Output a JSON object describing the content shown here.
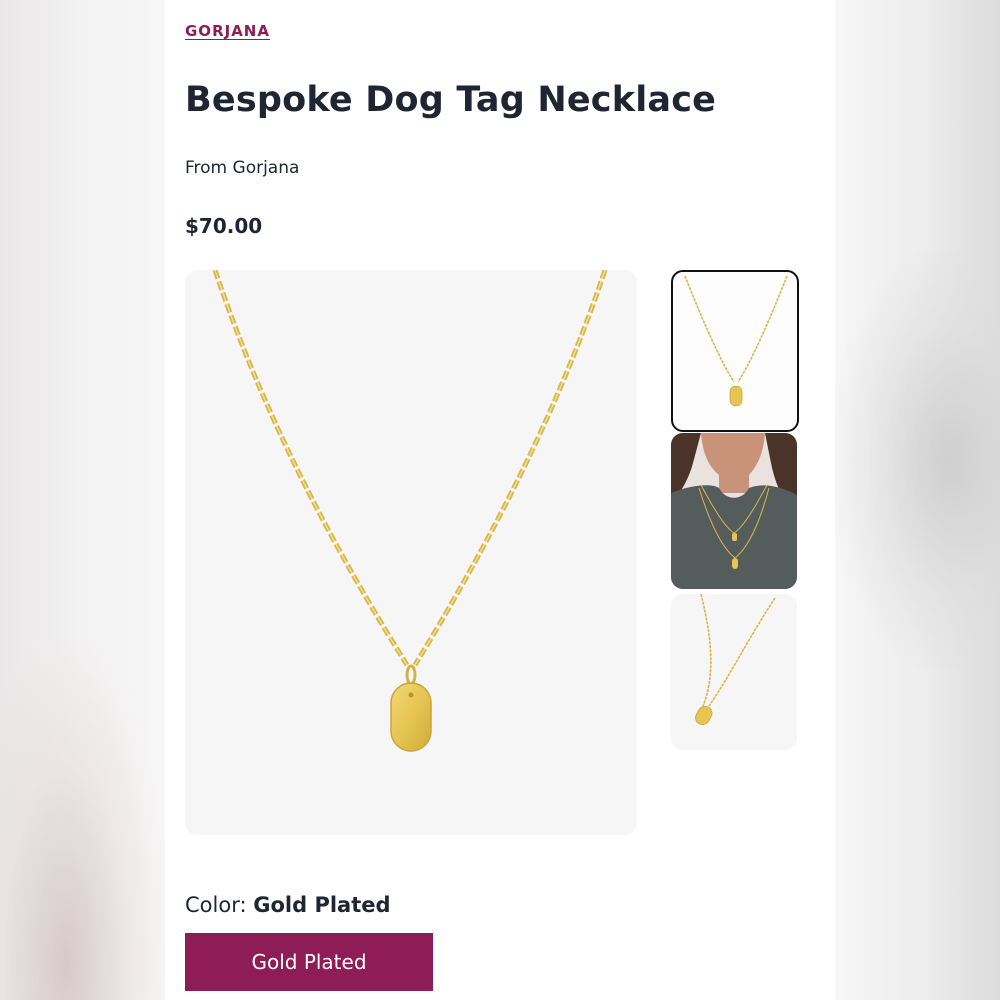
{
  "brand": {
    "name": "GORJANA",
    "color": "#8e1d57"
  },
  "product": {
    "title": "Bespoke Dog Tag Necklace",
    "from": "From Gorjana",
    "price": "$70.00"
  },
  "gallery": {
    "main_image": "gold-dog-tag-necklace",
    "thumbnails": [
      {
        "name": "necklace-front",
        "selected": true
      },
      {
        "name": "model-wearing-necklaces",
        "selected": false
      },
      {
        "name": "necklace-angled",
        "selected": false
      }
    ]
  },
  "color_selector": {
    "label": "Color:",
    "selected_value": "Gold Plated",
    "options": [
      "Gold Plated"
    ],
    "accent": "#8e1d57"
  },
  "colors": {
    "gold": "#e2c257",
    "text": "#1f2533"
  }
}
